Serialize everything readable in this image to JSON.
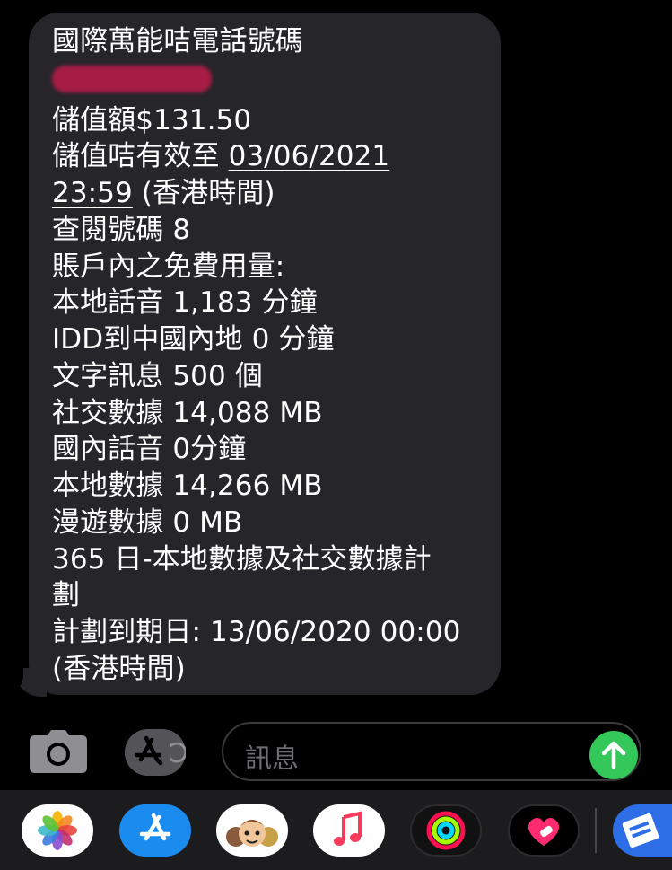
{
  "message": {
    "lines": [
      "國際萬能咭電話號碼",
      "儲值額$131.50",
      "儲值咭有效至 ",
      "03/06/2021",
      "23:59",
      " (香港時間)",
      "查閱號碼 8",
      "賬戶內之免費用量:",
      "本地話音 1,183 分鐘",
      "IDD到中國內地 0 分鐘",
      "文字訊息 500 個",
      "社交數據 14,088 MB",
      "國內話音 0分鐘",
      "本地數據 14,266 MB",
      "漫遊數據 0 MB",
      "365 日-本地數據及社交數據計",
      "劃",
      "計劃到期日: 13/06/2020 00:00",
      "(香港時間)"
    ]
  },
  "input": {
    "placeholder": "訊息"
  },
  "icons": {
    "camera": "camera-icon",
    "appstore": "app-store-icon",
    "send": "send-arrow-up-icon",
    "dock": [
      "photos-icon",
      "app-store-icon",
      "memoji-icon",
      "music-icon",
      "activity-icon",
      "heart-digital-touch-icon",
      "scanner-icon"
    ]
  },
  "colors": {
    "bubble": "#26252a",
    "send": "#34c759",
    "redaction": "#a81d45"
  }
}
